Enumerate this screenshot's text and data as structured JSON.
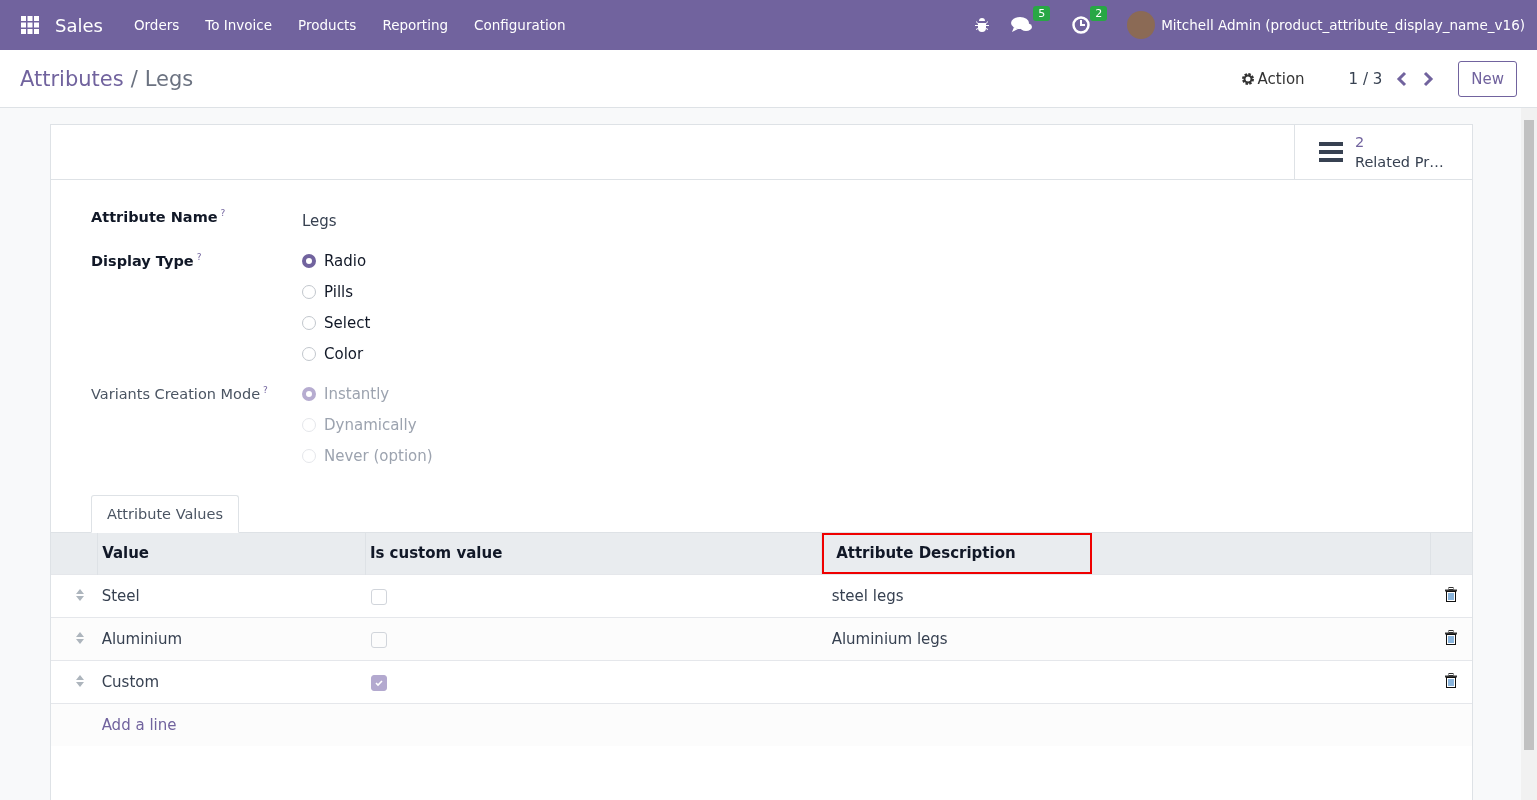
{
  "navbar": {
    "app": "Sales",
    "menu": [
      "Orders",
      "To Invoice",
      "Products",
      "Reporting",
      "Configuration"
    ],
    "messages_badge": "5",
    "activities_badge": "2",
    "user": "Mitchell Admin (product_attribute_display_name_v16)"
  },
  "control_panel": {
    "breadcrumb": "Attributes",
    "separator": "/",
    "current": "Legs",
    "action": "Action",
    "pager": "1 / 3",
    "new_button": "New"
  },
  "smart_button": {
    "count": "2",
    "label": "Related Pr…"
  },
  "form": {
    "name_label": "Attribute Name",
    "name_value": "Legs",
    "help_mark": "?",
    "display_type": {
      "label": "Display Type",
      "disabled": false,
      "options": [
        {
          "label": "Radio",
          "selected": true
        },
        {
          "label": "Pills",
          "selected": false
        },
        {
          "label": "Select",
          "selected": false
        },
        {
          "label": "Color",
          "selected": false
        }
      ]
    },
    "creation_mode": {
      "label": "Variants Creation Mode",
      "disabled": true,
      "options": [
        {
          "label": "Instantly",
          "selected": true
        },
        {
          "label": "Dynamically",
          "selected": false
        },
        {
          "label": "Never (option)",
          "selected": false
        }
      ]
    }
  },
  "tabs": [
    {
      "label": "Attribute Values",
      "selected": true
    }
  ],
  "table": {
    "columns": [
      {
        "label": "Value",
        "highlighted": false
      },
      {
        "label": "Is custom value",
        "highlighted": false
      },
      {
        "label": "Attribute Description",
        "highlighted": true
      }
    ],
    "rows": [
      {
        "value": "Steel",
        "checked": false,
        "description": "steel legs"
      },
      {
        "value": "Aluminium",
        "checked": false,
        "description": "Aluminium legs"
      },
      {
        "value": "Custom",
        "checked": true
      }
    ],
    "add_line": "Add a line"
  }
}
